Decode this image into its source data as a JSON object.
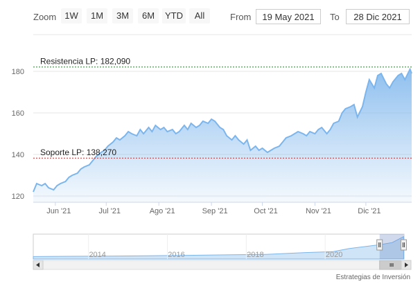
{
  "toolbar": {
    "zoom_label": "Zoom",
    "buttons": [
      "1W",
      "1M",
      "3M",
      "6M",
      "YTD",
      "All"
    ],
    "from_label": "From",
    "from_value": "19 May 2021",
    "to_label": "To",
    "to_value": "28 Dic 2021"
  },
  "credits": "Estrategias de Inversión",
  "chart_data": {
    "type": "area",
    "x": [
      "2021-05-19",
      "2021-05-21",
      "2021-05-24",
      "2021-05-26",
      "2021-05-28",
      "2021-05-31",
      "2021-06-02",
      "2021-06-04",
      "2021-06-07",
      "2021-06-09",
      "2021-06-11",
      "2021-06-14",
      "2021-06-16",
      "2021-06-18",
      "2021-06-21",
      "2021-06-23",
      "2021-06-25",
      "2021-06-28",
      "2021-06-30",
      "2021-07-02",
      "2021-07-05",
      "2021-07-07",
      "2021-07-09",
      "2021-07-12",
      "2021-07-14",
      "2021-07-16",
      "2021-07-19",
      "2021-07-21",
      "2021-07-23",
      "2021-07-26",
      "2021-07-28",
      "2021-07-30",
      "2021-08-02",
      "2021-08-04",
      "2021-08-06",
      "2021-08-09",
      "2021-08-11",
      "2021-08-13",
      "2021-08-16",
      "2021-08-18",
      "2021-08-20",
      "2021-08-23",
      "2021-08-25",
      "2021-08-27",
      "2021-08-30",
      "2021-09-01",
      "2021-09-03",
      "2021-09-06",
      "2021-09-08",
      "2021-09-10",
      "2021-09-13",
      "2021-09-15",
      "2021-09-17",
      "2021-09-20",
      "2021-09-22",
      "2021-09-24",
      "2021-09-27",
      "2021-09-29",
      "2021-10-01",
      "2021-10-04",
      "2021-10-06",
      "2021-10-08",
      "2021-10-11",
      "2021-10-13",
      "2021-10-15",
      "2021-10-18",
      "2021-10-20",
      "2021-10-22",
      "2021-10-25",
      "2021-10-27",
      "2021-10-29",
      "2021-11-01",
      "2021-11-03",
      "2021-11-05",
      "2021-11-08",
      "2021-11-10",
      "2021-11-12",
      "2021-11-15",
      "2021-11-17",
      "2021-11-19",
      "2021-11-22",
      "2021-11-24",
      "2021-11-26",
      "2021-11-29",
      "2021-12-01",
      "2021-12-03",
      "2021-12-06",
      "2021-12-08",
      "2021-12-10",
      "2021-12-13",
      "2021-12-15",
      "2021-12-17",
      "2021-12-20",
      "2021-12-22",
      "2021-12-24",
      "2021-12-27",
      "2021-12-28"
    ],
    "y": [
      122,
      126,
      125,
      126,
      124,
      123,
      125,
      126,
      127,
      129,
      130,
      131,
      133,
      134,
      135,
      137,
      139,
      141,
      142,
      144,
      146,
      148,
      147,
      149,
      151,
      150,
      149,
      152,
      150,
      153,
      151,
      154,
      152,
      153,
      151,
      152,
      150,
      151,
      154,
      152,
      155,
      153,
      154,
      156,
      155,
      157,
      156,
      153,
      152,
      149,
      147,
      149,
      147,
      145,
      147,
      142,
      144,
      142,
      143,
      141,
      142,
      143,
      144,
      146,
      148,
      149,
      150,
      151,
      150,
      149,
      151,
      150,
      152,
      153,
      150,
      152,
      155,
      156,
      160,
      162,
      163,
      164,
      158,
      163,
      170,
      176,
      172,
      178,
      179,
      174,
      172,
      175,
      178,
      179,
      176,
      181,
      179
    ],
    "title": "",
    "xlabel": "",
    "ylabel": "",
    "ylim": [
      118,
      186
    ],
    "y_ticks": [
      120,
      140,
      160,
      180
    ],
    "x_ticks": [
      {
        "date": "2021-06-01",
        "label": "Jun '21"
      },
      {
        "date": "2021-07-01",
        "label": "Jul '21"
      },
      {
        "date": "2021-08-01",
        "label": "Ago '21"
      },
      {
        "date": "2021-09-01",
        "label": "Sep '21"
      },
      {
        "date": "2021-10-01",
        "label": "Oct '21"
      },
      {
        "date": "2021-11-01",
        "label": "Nov '21"
      },
      {
        "date": "2021-12-01",
        "label": "Dic '21"
      }
    ],
    "grid": true,
    "series_color": "#7cb5ec",
    "annotations": [
      {
        "label": "Resistencia LP: 182,090",
        "value": 182.09,
        "color": "#2e7d32"
      },
      {
        "label": "Soporte LP: 138,270",
        "value": 138.27,
        "color": "#c62828"
      }
    ],
    "navigator": {
      "year_labels": [
        "2014",
        "2016",
        "2018",
        "2020"
      ],
      "year_positions": [
        2014,
        2016,
        2018,
        2020
      ],
      "x_range": [
        2012.6,
        2022.0
      ],
      "selected": [
        2021.38,
        2021.99
      ],
      "series": [
        {
          "year": 2012.6,
          "v": 0.1
        },
        {
          "year": 2013.5,
          "v": 0.11
        },
        {
          "year": 2014.5,
          "v": 0.12
        },
        {
          "year": 2015.5,
          "v": 0.13
        },
        {
          "year": 2016.5,
          "v": 0.15
        },
        {
          "year": 2017.5,
          "v": 0.17
        },
        {
          "year": 2018.5,
          "v": 0.19
        },
        {
          "year": 2019.5,
          "v": 0.26
        },
        {
          "year": 2020.2,
          "v": 0.3
        },
        {
          "year": 2020.6,
          "v": 0.42
        },
        {
          "year": 2021.0,
          "v": 0.5
        },
        {
          "year": 2021.4,
          "v": 0.58
        },
        {
          "year": 2021.7,
          "v": 0.66
        },
        {
          "year": 2021.99,
          "v": 0.9
        }
      ]
    }
  }
}
